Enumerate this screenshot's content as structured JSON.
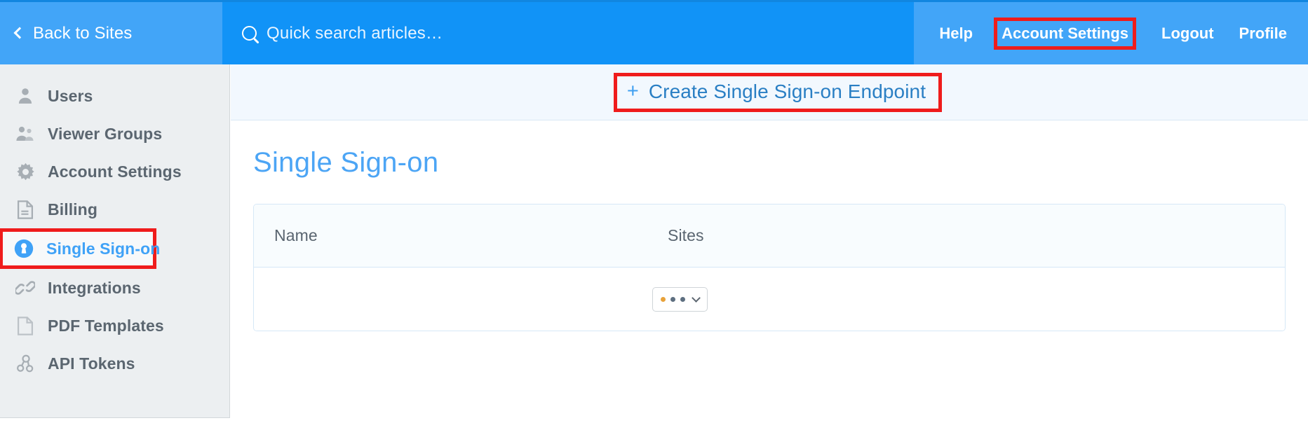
{
  "topbar": {
    "back_label": "Back to Sites",
    "search_placeholder": "Quick search articles…",
    "nav": [
      {
        "label": "Help",
        "highlighted": false
      },
      {
        "label": "Account Settings",
        "highlighted": true
      },
      {
        "label": "Logout",
        "highlighted": false
      },
      {
        "label": "Profile",
        "highlighted": false
      }
    ]
  },
  "sidebar": {
    "items": [
      {
        "label": "Users",
        "icon": "user-icon",
        "active": false
      },
      {
        "label": "Viewer Groups",
        "icon": "users-group-icon",
        "active": false
      },
      {
        "label": "Account Settings",
        "icon": "gear-icon",
        "active": false
      },
      {
        "label": "Billing",
        "icon": "document-icon",
        "active": false
      },
      {
        "label": "Single Sign-on",
        "icon": "keyhole-icon",
        "active": true
      },
      {
        "label": "Integrations",
        "icon": "link-icon",
        "active": false
      },
      {
        "label": "PDF Templates",
        "icon": "page-icon",
        "active": false
      },
      {
        "label": "API Tokens",
        "icon": "nodes-icon",
        "active": false
      }
    ]
  },
  "main": {
    "create_button": {
      "plus": "+",
      "label": "Create Single Sign-on Endpoint"
    },
    "page_title": "Single Sign-on",
    "table": {
      "columns": [
        "Name",
        "Sites"
      ],
      "rows": [
        {
          "name": "",
          "sites_select": "•••"
        }
      ]
    }
  },
  "colors": {
    "brand_blue": "#1193f7",
    "header_blue": "#42a5f8",
    "accent_link": "#4ca5f5",
    "highlight_red": "#ef1c1c",
    "sidebar_bg": "#eceff1"
  }
}
